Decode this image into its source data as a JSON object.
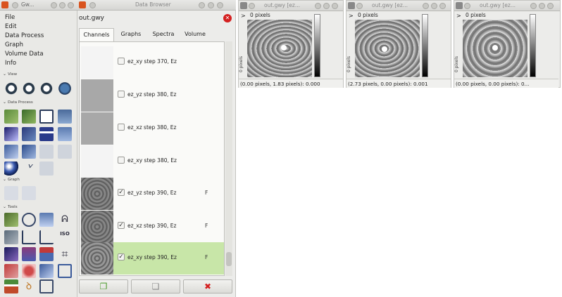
{
  "toolbox": {
    "title": "Gw...",
    "menu": [
      "File",
      "Edit",
      "Data Process",
      "Graph",
      "Volume Data",
      "Info"
    ],
    "sections": {
      "view": "View",
      "data_process": "Data Process",
      "graph": "Graph",
      "tools": "Tools"
    }
  },
  "browser": {
    "title": "Data Browser",
    "filename": "out.gwy",
    "tabs": [
      "Channels",
      "Graphs",
      "Spectra",
      "Volume"
    ],
    "rows": [
      {
        "label": "ez_xy step 370, Ez",
        "checked": false,
        "flag": ""
      },
      {
        "label": "ez_yz step 380, Ez",
        "checked": false,
        "flag": ""
      },
      {
        "label": "ez_xz step 380, Ez",
        "checked": false,
        "flag": ""
      },
      {
        "label": "ez_xy step 380, Ez",
        "checked": false,
        "flag": ""
      },
      {
        "label": "ez_yz step 390, Ez",
        "checked": true,
        "flag": "F"
      },
      {
        "label": "ez_xz step 390, Ez",
        "checked": true,
        "flag": "F"
      },
      {
        "label": "ez_xy step 390, Ez",
        "checked": true,
        "flag": "F"
      }
    ],
    "check_mark": "✓",
    "buttons": {
      "new": "new-channel",
      "duplicate": "duplicate-channel",
      "delete": "✖"
    }
  },
  "windows": [
    {
      "title": "out.gwy [ez...",
      "ruler": "0 pixels",
      "status": "(0.00 pixels, 1.83 pixels): 0.000"
    },
    {
      "title": "out.gwy [ez...",
      "ruler": "0 pixels",
      "status": "(2.73 pixels, 0.00 pixels): 0.001"
    },
    {
      "title": "out.gwy [ez...",
      "ruler": "0 pixels",
      "status": "(0.00 pixels, 0.00 pixels): 0..."
    }
  ],
  "side_ruler_label": "0 pixels",
  "ruler_arrow": ">",
  "colors": {
    "accent_orange": "#d9531e",
    "selected_row": "#c8e6a8",
    "delete_red": "#d42020"
  }
}
